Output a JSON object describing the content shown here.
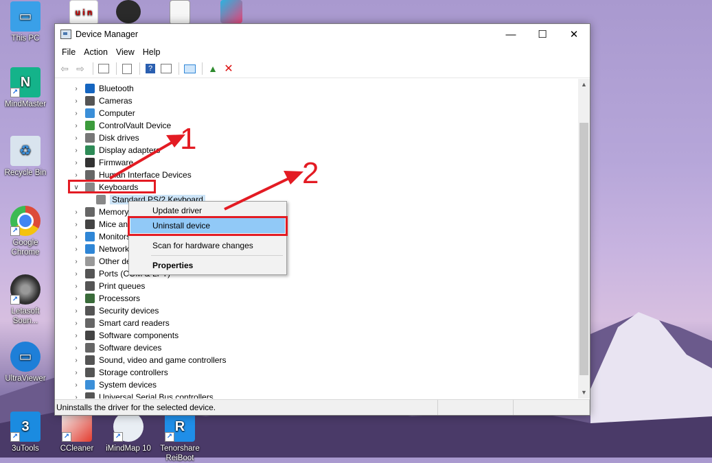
{
  "desktop": {
    "icons_left": [
      {
        "label": "This PC",
        "icon": "this-pc-icon",
        "color": "#3aa0e8"
      },
      {
        "label": "MindMaster",
        "icon": "mindmaster-icon",
        "color": "#14b38a"
      },
      {
        "label": "Recycle Bin",
        "icon": "recycle-bin-icon",
        "color": "#d9e4ee"
      },
      {
        "label": "Google Chrome",
        "icon": "chrome-icon",
        "color": "#dd4b39"
      },
      {
        "label": "Letasoft Soun...",
        "icon": "speaker-icon",
        "color": "#444444"
      },
      {
        "label": "UltraViewer",
        "icon": "ultraviewer-icon",
        "color": "#1e7fd8"
      }
    ],
    "icons_bottom": [
      {
        "label": "3uTools",
        "icon": "3utools-icon",
        "color": "#1b8be0",
        "glyph": "3"
      },
      {
        "label": "CCleaner",
        "icon": "ccleaner-icon",
        "color": "#e43d30"
      },
      {
        "label": "iMindMap 10",
        "icon": "imindmap-icon",
        "color": "#e9eef4"
      },
      {
        "label": "Tenorshare ReiBoot",
        "icon": "reiboot-icon",
        "color": "#1f8ee8",
        "glyph": "R"
      }
    ]
  },
  "window": {
    "title": "Device Manager",
    "controls": {
      "minimize": "—",
      "maximize": "☐",
      "close": "✕"
    },
    "menu": [
      "File",
      "Action",
      "View",
      "Help"
    ],
    "status_text": "Uninstalls the driver for the selected device."
  },
  "tree": [
    {
      "label": "Bluetooth",
      "icon": "bluetooth-icon",
      "color": "#1565c0",
      "expanded": false
    },
    {
      "label": "Cameras",
      "icon": "camera-icon",
      "color": "#555555",
      "expanded": false
    },
    {
      "label": "Computer",
      "icon": "computer-icon",
      "color": "#3b8fd8",
      "expanded": false
    },
    {
      "label": "ControlVault Device",
      "icon": "controlvault-icon",
      "color": "#3c9b3c",
      "expanded": false
    },
    {
      "label": "Disk drives",
      "icon": "disk-drive-icon",
      "color": "#777777",
      "expanded": false
    },
    {
      "label": "Display adapters",
      "icon": "display-adapter-icon",
      "color": "#2e8b57",
      "expanded": false
    },
    {
      "label": "Firmware",
      "icon": "firmware-icon",
      "color": "#333333",
      "expanded": false
    },
    {
      "label": "Human Interface Devices",
      "icon": "hid-icon",
      "color": "#666666",
      "expanded": false
    },
    {
      "label": "Keyboards",
      "icon": "keyboard-icon",
      "color": "#888888",
      "expanded": true
    },
    {
      "label": "Standard PS/2 Keyboard",
      "icon": "keyboard-icon",
      "color": "#888888",
      "child": true
    },
    {
      "label": "Memory technology devices",
      "icon": "memory-icon",
      "color": "#666666",
      "expanded": false
    },
    {
      "label": "Mice and other pointing devices",
      "icon": "mouse-icon",
      "color": "#444444",
      "expanded": false
    },
    {
      "label": "Monitors",
      "icon": "monitor-icon",
      "color": "#2f86d6",
      "expanded": false
    },
    {
      "label": "Network adapters",
      "icon": "network-adapter-icon",
      "color": "#2f86d6",
      "expanded": false
    },
    {
      "label": "Other devices",
      "icon": "other-devices-icon",
      "color": "#999999",
      "expanded": false
    },
    {
      "label": "Ports (COM & LPT)",
      "icon": "ports-icon",
      "color": "#555555",
      "expanded": false
    },
    {
      "label": "Print queues",
      "icon": "print-queue-icon",
      "color": "#555555",
      "expanded": false
    },
    {
      "label": "Processors",
      "icon": "processor-icon",
      "color": "#3a6b3a",
      "expanded": false
    },
    {
      "label": "Security devices",
      "icon": "security-device-icon",
      "color": "#555555",
      "expanded": false
    },
    {
      "label": "Smart card readers",
      "icon": "smart-card-icon",
      "color": "#666666",
      "expanded": false
    },
    {
      "label": "Software components",
      "icon": "software-component-icon",
      "color": "#444444",
      "expanded": false
    },
    {
      "label": "Software devices",
      "icon": "software-device-icon",
      "color": "#666666",
      "expanded": false
    },
    {
      "label": "Sound, video and game controllers",
      "icon": "sound-icon",
      "color": "#555555",
      "expanded": false
    },
    {
      "label": "Storage controllers",
      "icon": "storage-controller-icon",
      "color": "#555555",
      "expanded": false
    },
    {
      "label": "System devices",
      "icon": "system-device-icon",
      "color": "#3b8fd8",
      "expanded": false
    },
    {
      "label": "Universal Serial Bus controllers",
      "icon": "usb-icon",
      "color": "#555555",
      "expanded": false
    }
  ],
  "context_menu": {
    "items": [
      "Update driver",
      "Uninstall device",
      "Scan for hardware changes",
      "Properties"
    ],
    "highlighted": "Uninstall device"
  },
  "annotations": {
    "step1": "1",
    "step2": "2",
    "color": "#e31b23"
  }
}
